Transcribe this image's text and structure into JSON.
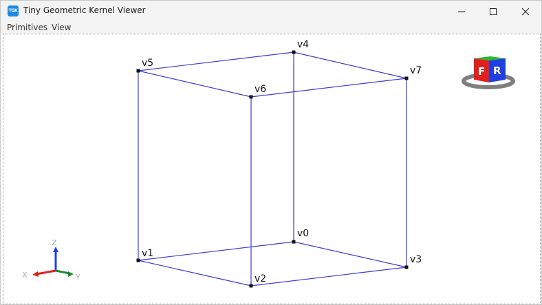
{
  "window": {
    "app_icon_text": "TGK",
    "title": "Tiny Geometric Kernel Viewer"
  },
  "menu": {
    "items": [
      {
        "label": "Primitives"
      },
      {
        "label": "View"
      }
    ]
  },
  "scene": {
    "vertices": [
      {
        "label": "v0"
      },
      {
        "label": "v1"
      },
      {
        "label": "v2"
      },
      {
        "label": "v3"
      },
      {
        "label": "v4"
      },
      {
        "label": "v5"
      },
      {
        "label": "v6"
      },
      {
        "label": "v7"
      }
    ],
    "edge_color": "#3a3ad6",
    "vertex_color": "#111111"
  },
  "view_cube": {
    "front_label": "F",
    "right_label": "R",
    "front_color": "#e0201b",
    "right_color": "#1f3fe0",
    "top_color": "#2db52d"
  },
  "axis_triad": {
    "x_label": "X",
    "y_label": "Y",
    "z_label": "Z",
    "x_color": "#e0201b",
    "y_color": "#1e8a2e",
    "z_color": "#1f3fe0"
  }
}
